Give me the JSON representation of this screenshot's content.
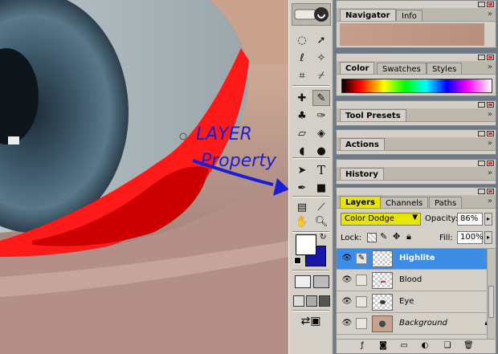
{
  "canvas": {
    "annotation_line1": "LAYER",
    "annotation_line2": "Property"
  },
  "toolbox": {
    "tools": [
      "marquee-icon",
      "move-icon",
      "lasso-icon",
      "magic-wand-icon",
      "crop-icon",
      "slice-icon",
      "healing-brush-icon",
      "brush-icon",
      "stamp-icon",
      "history-brush-icon",
      "eraser-icon",
      "paint-bucket-icon",
      "blur-icon",
      "dodge-icon",
      "path-select-icon",
      "type-icon",
      "pen-icon",
      "shape-icon",
      "notes-icon",
      "eyedropper-icon",
      "hand-icon",
      "zoom-icon"
    ],
    "colors": {
      "foreground": "#ffffff",
      "background": "#1a17a8"
    }
  },
  "panels": {
    "navigator": {
      "tabs": [
        "Navigator",
        "Info"
      ]
    },
    "color": {
      "tabs": [
        "Color",
        "Swatches",
        "Styles"
      ]
    },
    "tool_presets": {
      "tabs": [
        "Tool Presets"
      ]
    },
    "actions": {
      "tabs": [
        "Actions"
      ]
    },
    "history": {
      "tabs": [
        "History"
      ]
    },
    "layers": {
      "tabs": [
        "Layers",
        "Channels",
        "Paths"
      ],
      "blend_mode": "Color Dodge",
      "opacity_label": "Opacity:",
      "opacity": "86%",
      "lock_label": "Lock:",
      "fill_label": "Fill:",
      "fill": "100%",
      "rows": [
        {
          "name": "Highlite",
          "selected": true
        },
        {
          "name": "Blood",
          "selected": false
        },
        {
          "name": "Eye",
          "selected": false
        },
        {
          "name": "Background",
          "selected": false
        }
      ]
    }
  },
  "accent": {
    "selection": "#3d8de6",
    "highlight": "#e6e600",
    "annotation": "#1a1fd6"
  }
}
